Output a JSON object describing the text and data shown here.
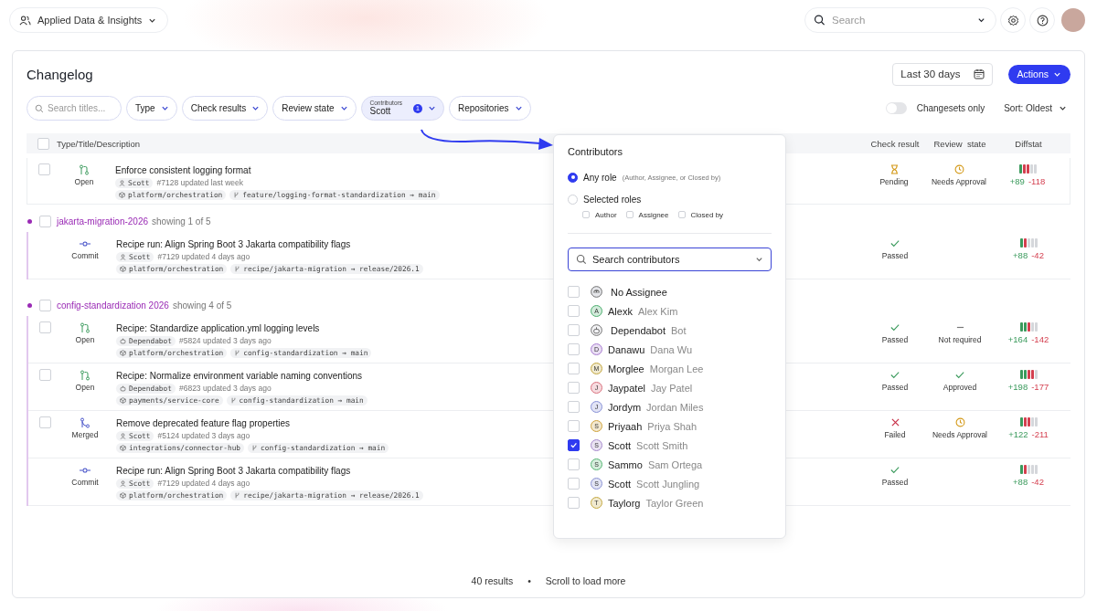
{
  "topbar": {
    "workspace": "Applied Data & Insights",
    "search_placeholder": "Search"
  },
  "page": {
    "title": "Changelog",
    "date_range": "Last 30 days",
    "actions": "Actions"
  },
  "filters": {
    "search_placeholder": "Search titles...",
    "chips": [
      {
        "label": "Type",
        "active": false
      },
      {
        "label": "Check results",
        "active": false
      },
      {
        "label": "Review state",
        "active": false
      },
      {
        "label": "Contributors",
        "value": "Scott",
        "count": "1",
        "active": true
      },
      {
        "label": "Repositories",
        "active": false
      }
    ],
    "changesets_only": {
      "label": "Changesets only",
      "on": false
    },
    "sort": "Sort: Oldest"
  },
  "table": {
    "header_checked": false,
    "columns": [
      "Type/Title/Description",
      "Check result",
      "Review  state",
      "Diffstat"
    ],
    "items": [
      {
        "kind": "open",
        "checked": false,
        "type_label": "Open",
        "title": "Enforce consistent logging format",
        "author": {
          "kind": "person",
          "name": "Scott"
        },
        "meta": "#7128 updated last week",
        "repo": "platform/orchestration",
        "branch": "feature/logging-format-standardization → main",
        "check": {
          "kind": "pending",
          "label": "Pending"
        },
        "review": {
          "kind": "needs_approval",
          "label": "Needs Approval"
        },
        "diff_bars": [
          {
            "color": "#3a9a5c"
          },
          {
            "color": "#d43f4f"
          },
          {
            "color": "#d43f4f"
          },
          {
            "color": "#d5d7db"
          },
          {
            "color": "#d5d7db"
          }
        ],
        "added": "+89",
        "removed": "-118"
      },
      {
        "kind": "group",
        "checked": false,
        "name": "jakarta-migration-2026",
        "showing": "showing 1 of 5",
        "rows": [
          {
            "kind": "commit",
            "type_label": "Commit",
            "title": "Recipe run: Align Spring Boot 3 Jakarta compatibility flags",
            "author": {
              "kind": "person",
              "name": "Scott"
            },
            "meta": "#7129 updated 4 days ago",
            "repo": "platform/orchestration",
            "branch": "recipe/jakarta-migration → release/2026.1",
            "check": {
              "kind": "passed",
              "label": "Passed"
            },
            "diff_bars": [
              {
                "color": "#3a9a5c"
              },
              {
                "color": "#d43f4f"
              },
              {
                "color": "#d5d7db"
              },
              {
                "color": "#d5d7db"
              },
              {
                "color": "#d5d7db"
              }
            ],
            "added": "+88",
            "removed": "-42"
          }
        ]
      },
      {
        "kind": "group",
        "checked": false,
        "name": "config-standardization 2026",
        "showing": "showing 4 of 5",
        "rows": [
          {
            "kind": "open",
            "checked": false,
            "type_label": "Open",
            "title": "Recipe: Standardize application.yml logging levels",
            "author": {
              "kind": "bot",
              "name": "Dependabot"
            },
            "meta": "#5824 updated 3 days ago",
            "repo": "platform/orchestration",
            "branch": "config-standardization → main",
            "check": {
              "kind": "passed",
              "label": "Passed"
            },
            "review": {
              "kind": "not_required",
              "label": "Not required"
            },
            "diff_bars": [
              {
                "color": "#3a9a5c"
              },
              {
                "color": "#3a9a5c"
              },
              {
                "color": "#d43f4f"
              },
              {
                "color": "#d5d7db"
              },
              {
                "color": "#d5d7db"
              }
            ],
            "added": "+164",
            "removed": "-142"
          },
          {
            "kind": "open",
            "checked": false,
            "type_label": "Open",
            "title": "Recipe: Normalize environment variable naming conventions",
            "author": {
              "kind": "bot",
              "name": "Dependabot"
            },
            "meta": "#6823 updated 3 days ago",
            "repo": "payments/service-core",
            "branch": "config-standardization → main",
            "check": {
              "kind": "passed",
              "label": "Passed"
            },
            "review": {
              "kind": "approved",
              "label": "Approved"
            },
            "diff_bars": [
              {
                "color": "#3a9a5c"
              },
              {
                "color": "#3a9a5c"
              },
              {
                "color": "#d43f4f"
              },
              {
                "color": "#d43f4f"
              },
              {
                "color": "#d5d7db"
              }
            ],
            "added": "+198",
            "removed": "-177"
          },
          {
            "kind": "merged",
            "checked": false,
            "type_label": "Merged",
            "title": "Remove deprecated feature flag properties",
            "author": {
              "kind": "person",
              "name": "Scott"
            },
            "meta": "#5124 updated 3 days ago",
            "repo": "integrations/connector-hub",
            "branch": "config-standardization → main",
            "check": {
              "kind": "failed",
              "label": "Failed"
            },
            "review": {
              "kind": "needs_approval",
              "label": "Needs Approval"
            },
            "diff_bars": [
              {
                "color": "#3a9a5c"
              },
              {
                "color": "#d43f4f"
              },
              {
                "color": "#d43f4f"
              },
              {
                "color": "#d5d7db"
              },
              {
                "color": "#d5d7db"
              }
            ],
            "added": "+122",
            "removed": "-211"
          },
          {
            "kind": "commit",
            "type_label": "Commit",
            "title": "Recipe run: Align Spring Boot 3 Jakarta compatibility flags",
            "author": {
              "kind": "person",
              "name": "Scott"
            },
            "meta": "#7129 updated 4 days ago",
            "repo": "platform/orchestration",
            "branch": "recipe/jakarta-migration → release/2026.1",
            "check": {
              "kind": "passed",
              "label": "Passed"
            },
            "diff_bars": [
              {
                "color": "#3a9a5c"
              },
              {
                "color": "#d43f4f"
              },
              {
                "color": "#d5d7db"
              },
              {
                "color": "#d5d7db"
              },
              {
                "color": "#d5d7db"
              }
            ],
            "added": "+88",
            "removed": "-42"
          }
        ]
      }
    ]
  },
  "popover": {
    "title": "Contributors",
    "roles": [
      {
        "label": "Any role",
        "hint": "(Author, Assignee, or Closed by)",
        "selected": true
      },
      {
        "label": "Selected roles",
        "selected": false
      }
    ],
    "role_checks": [
      {
        "label": "Author",
        "checked": false
      },
      {
        "label": "Assignee",
        "checked": false
      },
      {
        "label": "Closed by",
        "checked": false
      }
    ],
    "search_placeholder": "Search contributors",
    "contributors": [
      {
        "kind": "icon",
        "handle": "No Assignee",
        "checked": false
      },
      {
        "kind": "letter",
        "letter": "A",
        "handle": "Alexk",
        "name": "Alex Kim",
        "color": "#4caf6e",
        "checked": false
      },
      {
        "kind": "bot",
        "handle": "Dependabot",
        "name": "Bot",
        "checked": false
      },
      {
        "kind": "letter",
        "letter": "D",
        "handle": "Danawu",
        "name": "Dana Wu",
        "color": "#a77bd0",
        "checked": false
      },
      {
        "kind": "letter",
        "letter": "M",
        "handle": "Morglee",
        "name": "Morgan Lee",
        "color": "#c2a53c",
        "checked": false
      },
      {
        "kind": "letter",
        "letter": "J",
        "handle": "Jaypatel",
        "name": "Jay Patel",
        "color": "#d9707d",
        "checked": false
      },
      {
        "kind": "letter",
        "letter": "J",
        "handle": "Jordym",
        "name": "Jordan Miles",
        "color": "#8790d6",
        "checked": false
      },
      {
        "kind": "letter",
        "letter": "S",
        "handle": "Priyaah",
        "name": "Priya Shah",
        "color": "#cfa23a",
        "checked": false
      },
      {
        "kind": "letter",
        "letter": "S",
        "handle": "Scott",
        "name": "Scott Smith",
        "color": "#a689cc",
        "checked": true
      },
      {
        "kind": "letter",
        "letter": "S",
        "handle": "Sammo",
        "name": "Sam Ortega",
        "color": "#56b573",
        "checked": false
      },
      {
        "kind": "letter",
        "letter": "S",
        "handle": "Scott",
        "name": "Scott Jungling",
        "color": "#8a92d4",
        "checked": false
      },
      {
        "kind": "letter",
        "letter": "T",
        "handle": "Taylorg",
        "name": "Taylor Green",
        "color": "#c4a840",
        "checked": false
      }
    ]
  },
  "footer": {
    "results": "40 results",
    "separator": "•",
    "hint": "Scroll to load more"
  }
}
